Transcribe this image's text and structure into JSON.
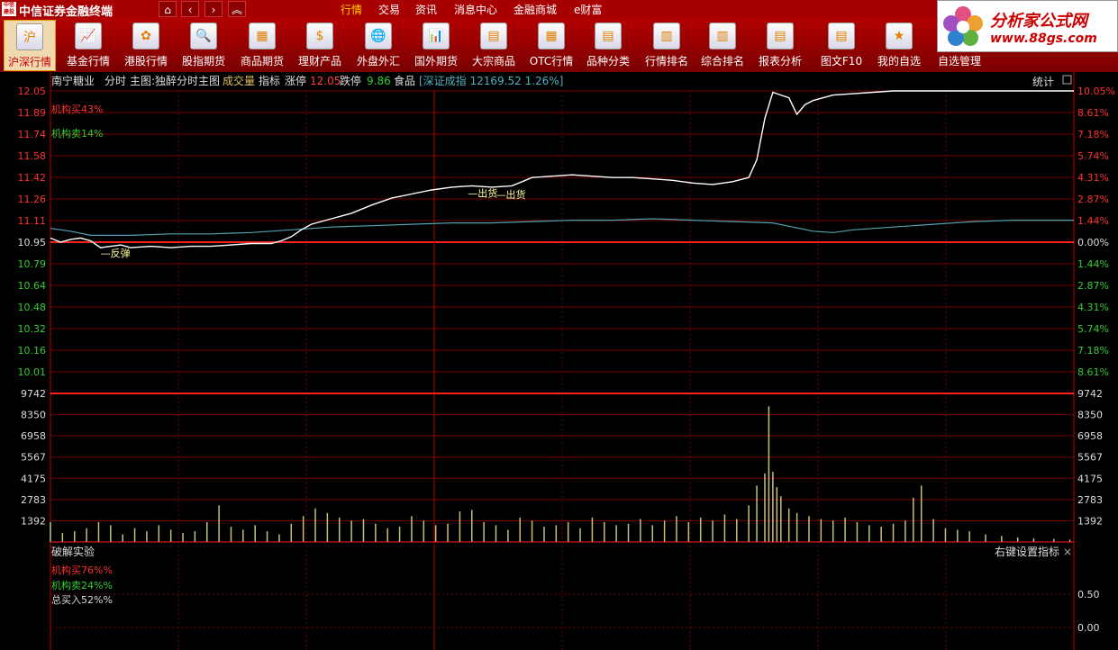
{
  "app": {
    "logo_text": "中信建投",
    "title": "中信证券金融终端"
  },
  "menu": [
    "行情",
    "交易",
    "资讯",
    "消息中心",
    "金融商城",
    "e财富"
  ],
  "menu_active_index": 0,
  "brand": {
    "name": "分析家公式网",
    "url": "www.88gs.com"
  },
  "toolbar": [
    {
      "label": "沪深行情",
      "icon": "shanghai-shenzhen-icon",
      "active": true
    },
    {
      "label": "基金行情",
      "icon": "fund-chart-icon"
    },
    {
      "label": "港股行情",
      "icon": "hongkong-flower-icon"
    },
    {
      "label": "股指期货",
      "icon": "index-futures-icon"
    },
    {
      "label": "商品期货",
      "icon": "commodity-futures-icon"
    },
    {
      "label": "理财产品",
      "icon": "dollar-icon"
    },
    {
      "label": "外盘外汇",
      "icon": "globe-forex-icon"
    },
    {
      "label": "国外期货",
      "icon": "foreign-futures-icon"
    },
    {
      "label": "大宗商品",
      "icon": "bulk-commodity-icon"
    },
    {
      "label": "OTC行情",
      "icon": "otc-grid-icon"
    },
    {
      "label": "品种分类",
      "icon": "category-icon"
    },
    {
      "label": "行情排名",
      "icon": "ranking-icon"
    },
    {
      "label": "综合排名",
      "icon": "overall-ranking-icon"
    },
    {
      "label": "报表分析",
      "icon": "report-icon"
    },
    {
      "label": "图文F10",
      "icon": "f10-icon"
    },
    {
      "label": "我的自选",
      "icon": "favorites-icon"
    },
    {
      "label": "自选管理",
      "icon": "favorites-manage-icon"
    }
  ],
  "header": {
    "stock_name": "南宁糖业",
    "mode": "分时",
    "main_chart": "主图:独醉分时主图",
    "volume_label": "成交量",
    "indicator_label": "指标",
    "limit_up_label": "涨停",
    "limit_up_value": "12.05",
    "limit_down_label": "跌停",
    "limit_down_value": "9.86",
    "sector": "食品",
    "index_text": "[深证成指 12169.52 1.26%]",
    "stats_label": "统计"
  },
  "price_panel": {
    "left_ticks": [
      "12.05",
      "11.89",
      "11.74",
      "11.58",
      "11.42",
      "11.26",
      "11.11",
      "10.95",
      "10.79",
      "10.64",
      "10.48",
      "10.32",
      "10.16",
      "10.01"
    ],
    "right_ticks": [
      "10.05%",
      "8.61%",
      "7.18%",
      "5.74%",
      "4.31%",
      "2.87%",
      "1.44%",
      "0.00%",
      "1.44%",
      "2.87%",
      "4.31%",
      "5.74%",
      "7.18%",
      "8.61%"
    ],
    "inst_buy": "机构买43%",
    "inst_sell": "机构卖14%",
    "annotations": [
      {
        "text": "反弹",
        "time_index": 25
      },
      {
        "text": "出货",
        "time_index": 208
      },
      {
        "text": "出货",
        "time_index": 222
      }
    ]
  },
  "volume_panel": {
    "ticks": [
      "9742",
      "8350",
      "6958",
      "5567",
      "4175",
      "2783",
      "1392"
    ]
  },
  "indicator_panel": {
    "title": "破解实验",
    "settings_label": "右键设置指标",
    "close_symbol": "×",
    "inst_buy": "机构买76%%",
    "inst_sell": "机构卖24%%",
    "total_buy": "总买入52%%",
    "right_ticks": [
      "0.50",
      "0.00"
    ]
  },
  "chart_data": {
    "type": "line",
    "price_range": [
      9.86,
      12.05
    ],
    "prev_close": 10.95,
    "volume_max": 9742,
    "price_points": [
      [
        0,
        10.98
      ],
      [
        5,
        10.95
      ],
      [
        10,
        10.97
      ],
      [
        15,
        10.98
      ],
      [
        20,
        10.96
      ],
      [
        25,
        10.91
      ],
      [
        30,
        10.92
      ],
      [
        35,
        10.93
      ],
      [
        40,
        10.91
      ],
      [
        50,
        10.92
      ],
      [
        60,
        10.91
      ],
      [
        70,
        10.92
      ],
      [
        80,
        10.92
      ],
      [
        90,
        10.93
      ],
      [
        100,
        10.94
      ],
      [
        110,
        10.94
      ],
      [
        115,
        10.96
      ],
      [
        120,
        10.99
      ],
      [
        125,
        11.04
      ],
      [
        130,
        11.08
      ],
      [
        140,
        11.12
      ],
      [
        150,
        11.16
      ],
      [
        160,
        11.22
      ],
      [
        170,
        11.27
      ],
      [
        180,
        11.3
      ],
      [
        190,
        11.33
      ],
      [
        200,
        11.35
      ],
      [
        210,
        11.36
      ],
      [
        220,
        11.35
      ],
      [
        230,
        11.36
      ],
      [
        240,
        11.42
      ],
      [
        250,
        11.43
      ],
      [
        260,
        11.44
      ],
      [
        270,
        11.43
      ],
      [
        280,
        11.42
      ],
      [
        290,
        11.42
      ],
      [
        300,
        11.41
      ],
      [
        310,
        11.4
      ],
      [
        320,
        11.38
      ],
      [
        330,
        11.37
      ],
      [
        340,
        11.39
      ],
      [
        348,
        11.42
      ],
      [
        352,
        11.55
      ],
      [
        356,
        11.85
      ],
      [
        360,
        12.04
      ],
      [
        364,
        12.02
      ],
      [
        368,
        12.0
      ],
      [
        372,
        11.88
      ],
      [
        376,
        11.95
      ],
      [
        380,
        11.98
      ],
      [
        390,
        12.02
      ],
      [
        400,
        12.03
      ],
      [
        410,
        12.04
      ],
      [
        420,
        12.05
      ],
      [
        440,
        12.05
      ],
      [
        460,
        12.05
      ],
      [
        480,
        12.05
      ],
      [
        510,
        12.05
      ]
    ],
    "avg_points": [
      [
        0,
        11.05
      ],
      [
        10,
        11.03
      ],
      [
        20,
        11.0
      ],
      [
        40,
        11.0
      ],
      [
        60,
        11.01
      ],
      [
        80,
        11.01
      ],
      [
        100,
        11.02
      ],
      [
        120,
        11.04
      ],
      [
        140,
        11.06
      ],
      [
        160,
        11.07
      ],
      [
        180,
        11.08
      ],
      [
        200,
        11.09
      ],
      [
        220,
        11.09
      ],
      [
        240,
        11.1
      ],
      [
        260,
        11.11
      ],
      [
        280,
        11.11
      ],
      [
        300,
        11.12
      ],
      [
        320,
        11.11
      ],
      [
        340,
        11.1
      ],
      [
        360,
        11.09
      ],
      [
        370,
        11.06
      ],
      [
        380,
        11.03
      ],
      [
        390,
        11.02
      ],
      [
        400,
        11.04
      ],
      [
        420,
        11.06
      ],
      [
        440,
        11.08
      ],
      [
        460,
        11.1
      ],
      [
        480,
        11.11
      ],
      [
        510,
        11.11
      ]
    ],
    "volumes": [
      {
        "i": 0,
        "v": 1300
      },
      {
        "i": 6,
        "v": 600
      },
      {
        "i": 12,
        "v": 700
      },
      {
        "i": 18,
        "v": 900
      },
      {
        "i": 24,
        "v": 1300
      },
      {
        "i": 30,
        "v": 1100
      },
      {
        "i": 36,
        "v": 500
      },
      {
        "i": 42,
        "v": 900
      },
      {
        "i": 48,
        "v": 700
      },
      {
        "i": 54,
        "v": 1100
      },
      {
        "i": 60,
        "v": 800
      },
      {
        "i": 66,
        "v": 600
      },
      {
        "i": 72,
        "v": 700
      },
      {
        "i": 78,
        "v": 1300
      },
      {
        "i": 84,
        "v": 2400
      },
      {
        "i": 90,
        "v": 1000
      },
      {
        "i": 96,
        "v": 800
      },
      {
        "i": 102,
        "v": 1100
      },
      {
        "i": 108,
        "v": 700
      },
      {
        "i": 114,
        "v": 500
      },
      {
        "i": 120,
        "v": 1200
      },
      {
        "i": 126,
        "v": 1700
      },
      {
        "i": 132,
        "v": 2200
      },
      {
        "i": 138,
        "v": 1900
      },
      {
        "i": 144,
        "v": 1600
      },
      {
        "i": 150,
        "v": 1400
      },
      {
        "i": 156,
        "v": 1500
      },
      {
        "i": 162,
        "v": 1200
      },
      {
        "i": 168,
        "v": 900
      },
      {
        "i": 174,
        "v": 1000
      },
      {
        "i": 180,
        "v": 1700
      },
      {
        "i": 186,
        "v": 1400
      },
      {
        "i": 192,
        "v": 1100
      },
      {
        "i": 198,
        "v": 1200
      },
      {
        "i": 204,
        "v": 2000
      },
      {
        "i": 210,
        "v": 2100
      },
      {
        "i": 216,
        "v": 1300
      },
      {
        "i": 222,
        "v": 1100
      },
      {
        "i": 228,
        "v": 800
      },
      {
        "i": 234,
        "v": 1600
      },
      {
        "i": 240,
        "v": 1400
      },
      {
        "i": 246,
        "v": 1000
      },
      {
        "i": 252,
        "v": 1100
      },
      {
        "i": 258,
        "v": 1300
      },
      {
        "i": 264,
        "v": 900
      },
      {
        "i": 270,
        "v": 1600
      },
      {
        "i": 276,
        "v": 1300
      },
      {
        "i": 282,
        "v": 1100
      },
      {
        "i": 288,
        "v": 1200
      },
      {
        "i": 294,
        "v": 1500
      },
      {
        "i": 300,
        "v": 1100
      },
      {
        "i": 306,
        "v": 1400
      },
      {
        "i": 312,
        "v": 1700
      },
      {
        "i": 318,
        "v": 1300
      },
      {
        "i": 324,
        "v": 1600
      },
      {
        "i": 330,
        "v": 1400
      },
      {
        "i": 336,
        "v": 1800
      },
      {
        "i": 342,
        "v": 1500
      },
      {
        "i": 348,
        "v": 2400
      },
      {
        "i": 352,
        "v": 3700
      },
      {
        "i": 356,
        "v": 4500
      },
      {
        "i": 358,
        "v": 8900
      },
      {
        "i": 360,
        "v": 4600
      },
      {
        "i": 362,
        "v": 3600
      },
      {
        "i": 364,
        "v": 3000
      },
      {
        "i": 368,
        "v": 2200
      },
      {
        "i": 372,
        "v": 1900
      },
      {
        "i": 378,
        "v": 1700
      },
      {
        "i": 384,
        "v": 1500
      },
      {
        "i": 390,
        "v": 1400
      },
      {
        "i": 396,
        "v": 1600
      },
      {
        "i": 402,
        "v": 1300
      },
      {
        "i": 408,
        "v": 1100
      },
      {
        "i": 414,
        "v": 1000
      },
      {
        "i": 420,
        "v": 1200
      },
      {
        "i": 426,
        "v": 1400
      },
      {
        "i": 430,
        "v": 2900
      },
      {
        "i": 434,
        "v": 3700
      },
      {
        "i": 440,
        "v": 1500
      },
      {
        "i": 446,
        "v": 900
      },
      {
        "i": 452,
        "v": 800
      },
      {
        "i": 458,
        "v": 700
      },
      {
        "i": 466,
        "v": 500
      },
      {
        "i": 474,
        "v": 400
      },
      {
        "i": 482,
        "v": 300
      },
      {
        "i": 490,
        "v": 250
      },
      {
        "i": 500,
        "v": 200
      },
      {
        "i": 508,
        "v": 150
      }
    ]
  },
  "colors": {
    "grid": "#7a0000",
    "grid_bright": "#c00000",
    "price_line": "#ffffff",
    "avg_line": "#4fa0b0",
    "up": "#ff3030",
    "down": "#33cc33",
    "volume_bar": "#c8c07a",
    "annotation": "#ffff99"
  }
}
